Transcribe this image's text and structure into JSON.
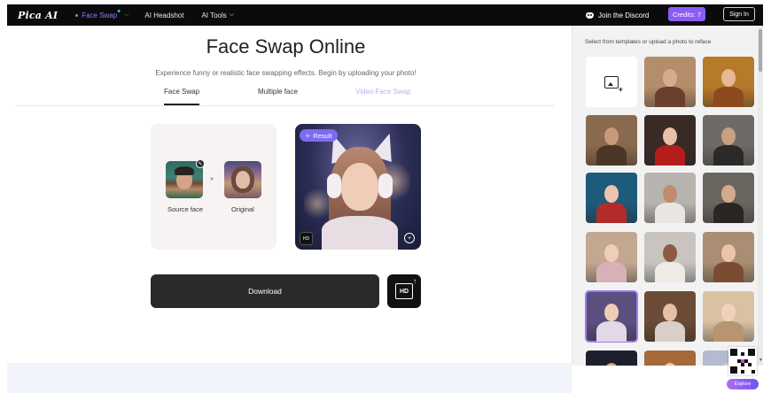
{
  "nav": {
    "logo": "Pica AI",
    "items": [
      {
        "label": "Face Swap",
        "active": true
      },
      {
        "label": "AI Headshot",
        "active": false
      },
      {
        "label": "AI Tools",
        "active": false
      }
    ],
    "discord_label": "Join the Discord",
    "credits_label": "Credits: 7",
    "signin_label": "Sign In"
  },
  "main": {
    "title": "Face Swap Online",
    "subtitle": "Experience funny or realistic face swapping effects. Begin by uploading your photo!",
    "tabs": [
      "Face Swap",
      "Multiple face",
      "Video Face Swap"
    ],
    "source_label": "Source face",
    "original_label": "Original",
    "arrows": "»",
    "result_badge": "Result",
    "download_label": "Download",
    "hd_label": "HD"
  },
  "panel": {
    "title": "Select from templates or upload a photo to reface",
    "templates": [
      {
        "type": "upload",
        "icon": "image-plus-icon"
      },
      {
        "type": "photo",
        "bg": "#b48d6b",
        "head": "#d9aa8c",
        "body": "#6a3f2e"
      },
      {
        "type": "photo",
        "bg": "#b57a2a",
        "head": "#e7b898",
        "body": "#8c4a1e"
      },
      {
        "type": "photo",
        "bg": "#8a6a4e",
        "head": "#c79a7a",
        "body": "#4a3526"
      },
      {
        "type": "photo",
        "bg": "#3a2a26",
        "head": "#e6c0a9",
        "body": "#b51d1d"
      },
      {
        "type": "photo",
        "bg": "#6e6a66",
        "head": "#c8a083",
        "body": "#2a2a2a"
      },
      {
        "type": "photo",
        "bg": "#1e5a7a",
        "head": "#ecc4ae",
        "body": "#b42b2b"
      },
      {
        "type": "photo",
        "bg": "#b7b3ae",
        "head": "#bf8d6d",
        "body": "#e9e6e2"
      },
      {
        "type": "photo",
        "bg": "#6b6560",
        "head": "#d3aa8e",
        "body": "#2a2624"
      },
      {
        "type": "photo",
        "bg": "#c2a890",
        "head": "#efcdb8",
        "body": "#d8b0b8"
      },
      {
        "type": "photo",
        "bg": "#c9c4bf",
        "head": "#8c5a40",
        "body": "#efeae6"
      },
      {
        "type": "photo",
        "bg": "#a98e73",
        "head": "#e9c5ac",
        "body": "#7b4c32"
      },
      {
        "type": "photo",
        "bg": "#5b4f7d",
        "head": "#efcdb8",
        "body": "#e3d8e6",
        "selected": true
      },
      {
        "type": "photo",
        "bg": "#6b4a36",
        "head": "#e5bfa6",
        "body": "#d8cfc8"
      },
      {
        "type": "photo",
        "bg": "#d8c2a2",
        "head": "#f0d2bc",
        "body": "#b89570"
      },
      {
        "type": "photo",
        "bg": "#1d1f2c",
        "head": "#d3a487",
        "body": "#2a2a3a"
      },
      {
        "type": "photo",
        "bg": "#a7683a",
        "head": "#f0c7a4",
        "body": "#7a3e1a"
      },
      {
        "type": "photo",
        "bg": "#b5bad0",
        "head": "#e8cbb9",
        "body": "#98a0be"
      }
    ]
  },
  "widget": {
    "explore_label": "Explore"
  }
}
